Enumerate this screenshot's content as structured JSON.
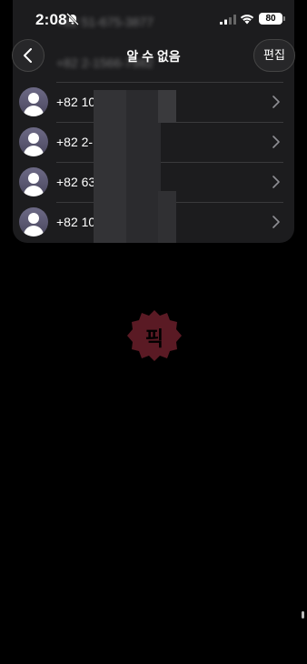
{
  "status_bar": {
    "time": "2:08",
    "battery": "80"
  },
  "nav": {
    "title": "알 수 없음",
    "edit_label": "편집"
  },
  "blurred_rows": [
    {
      "number": "+82 51-675-3877"
    },
    {
      "number": "+82 2-1566-7982"
    }
  ],
  "contacts": [
    {
      "number": "+82 10"
    },
    {
      "number": "+82 2-"
    },
    {
      "number": "+82 63"
    },
    {
      "number": "+82 10"
    }
  ],
  "watermark": {
    "text": "픽",
    "color": "#5a1a24"
  }
}
